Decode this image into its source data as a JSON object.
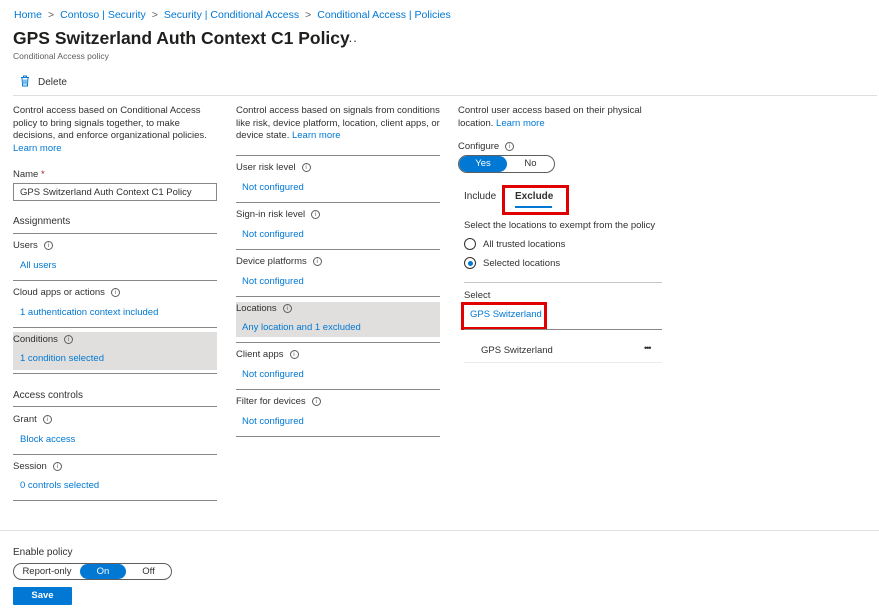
{
  "breadcrumb": [
    "Home",
    "Contoso | Security",
    "Security | Conditional Access",
    "Conditional Access | Policies"
  ],
  "breadcrumb_separator": ">",
  "page": {
    "title": "GPS Switzerland Auth Context C1 Policy",
    "more_label": "...",
    "subtitle": "Conditional Access policy"
  },
  "toolbar": {
    "delete_label": "Delete",
    "delete_icon": "trash-icon"
  },
  "col1": {
    "description": "Control access based on Conditional Access policy to bring signals together, to make decisions, and enforce organizational policies.",
    "learn_more": "Learn more",
    "name_label": "Name",
    "name_required": "*",
    "name_value": "GPS Switzerland Auth Context C1 Policy",
    "assignments_heading": "Assignments",
    "users_label": "Users",
    "users_value": "All users",
    "cloud_label": "Cloud apps or actions",
    "cloud_value": "1 authentication context included",
    "conditions_label": "Conditions",
    "conditions_value": "1 condition selected",
    "access_heading": "Access controls",
    "grant_label": "Grant",
    "grant_value": "Block access",
    "session_label": "Session",
    "session_value": "0 controls selected"
  },
  "col2": {
    "description": "Control access based on signals from conditions like risk, device platform, location, client apps, or device state.",
    "learn_more": "Learn more",
    "rows": [
      {
        "label": "User risk level",
        "value": "Not configured"
      },
      {
        "label": "Sign-in risk level",
        "value": "Not configured"
      },
      {
        "label": "Device platforms",
        "value": "Not configured"
      },
      {
        "label": "Locations",
        "value": "Any location and 1 excluded"
      },
      {
        "label": "Client apps",
        "value": "Not configured"
      },
      {
        "label": "Filter for devices",
        "value": "Not configured"
      }
    ]
  },
  "col3": {
    "description": "Control user access based on their physical location.",
    "learn_more": "Learn more",
    "configure_label": "Configure",
    "configure_options": [
      "Yes",
      "No"
    ],
    "configure_selected": "Yes",
    "tabs": [
      "Include",
      "Exclude"
    ],
    "active_tab": "Exclude",
    "exclude_prompt": "Select the locations to exempt from the policy",
    "radio_options": [
      "All trusted locations",
      "Selected locations"
    ],
    "radio_selected": "Selected locations",
    "select_label": "Select",
    "select_value": "GPS Switzerland",
    "list_item": "GPS Switzerland",
    "list_more": "•••"
  },
  "footer": {
    "enable_label": "Enable policy",
    "options": [
      "Report-only",
      "On",
      "Off"
    ],
    "selected": "On",
    "save_label": "Save"
  },
  "colors": {
    "accent": "#0078d4",
    "highlight_box": "#e00000",
    "shaded_row": "#e1dfdd"
  }
}
